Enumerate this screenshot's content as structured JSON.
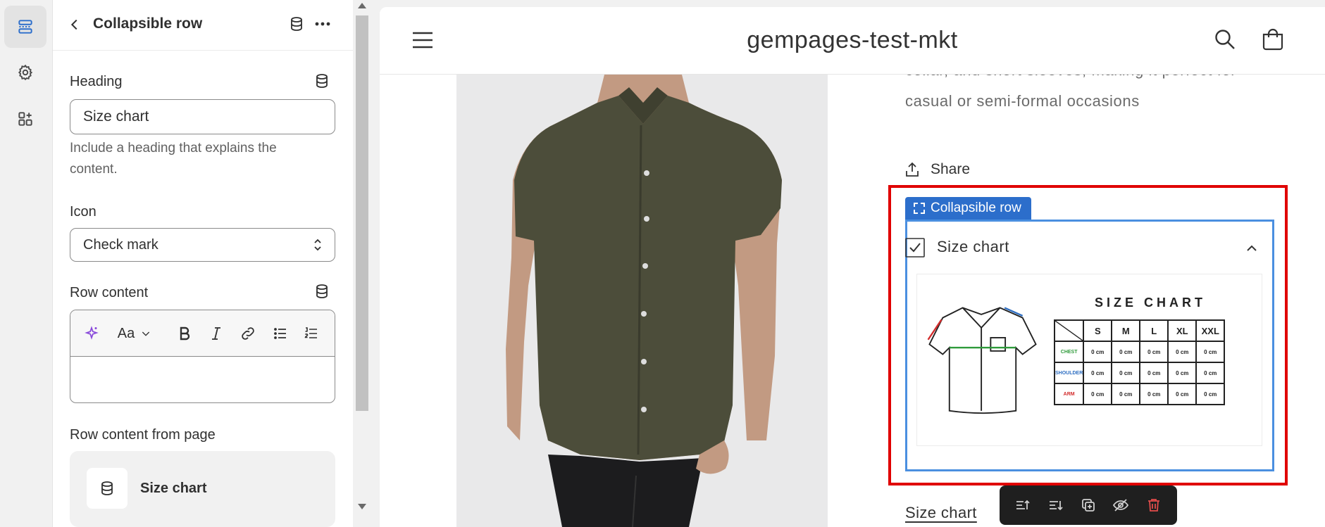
{
  "rail": {
    "items": [
      {
        "icon": "sections-icon",
        "active": true
      },
      {
        "icon": "gear-icon",
        "active": false
      },
      {
        "icon": "apps-add-icon",
        "active": false
      }
    ]
  },
  "panel": {
    "title": "Collapsible row",
    "heading": {
      "label": "Heading",
      "value": "Size chart",
      "help": "Include a heading that explains the content."
    },
    "icon_field": {
      "label": "Icon",
      "selected": "Check mark"
    },
    "row_content": {
      "label": "Row content",
      "toolbar": [
        "magic-icon",
        "text-format-icon",
        "bold-icon",
        "italic-icon",
        "link-icon",
        "bullet-list-icon",
        "numbered-list-icon"
      ],
      "text_format_label": "Aa",
      "value": ""
    },
    "row_content_page": {
      "label": "Row content from page",
      "page_name": "Size chart"
    }
  },
  "preview": {
    "store_name": "gempages-test-mkt",
    "description": "collar, and short sleeves, making it perfect for casual or semi-formal occasions",
    "share_label": "Share",
    "selection_tag": "Collapsible row",
    "accordion_title": "Size chart",
    "size_chart": {
      "heading": "SIZE CHART",
      "sizes": [
        "S",
        "M",
        "L",
        "XL",
        "XXL"
      ],
      "rows": [
        {
          "label": "CHEST",
          "color": "#2e9a3a",
          "cells": [
            "0 cm",
            "0 cm",
            "0 cm",
            "0 cm",
            "0 cm"
          ]
        },
        {
          "label": "SHOULDER",
          "color": "#2f6fc2",
          "cells": [
            "0 cm",
            "0 cm",
            "0 cm",
            "0 cm",
            "0 cm"
          ]
        },
        {
          "label": "ARM",
          "color": "#d22b2b",
          "cells": [
            "0 cm",
            "0 cm",
            "0 cm",
            "0 cm",
            "0 cm"
          ]
        }
      ]
    },
    "size_chart_link": "Size chart",
    "floating_toolbar": [
      "move-up-icon",
      "move-down-icon",
      "duplicate-icon",
      "hide-icon",
      "delete-icon"
    ]
  },
  "colors": {
    "selection_red": "#e00000",
    "selection_blue": "#4a8fe0",
    "tag_blue": "#2c6ecb",
    "delete_red": "#e24c4b",
    "shirt": "#4c4d3a"
  }
}
